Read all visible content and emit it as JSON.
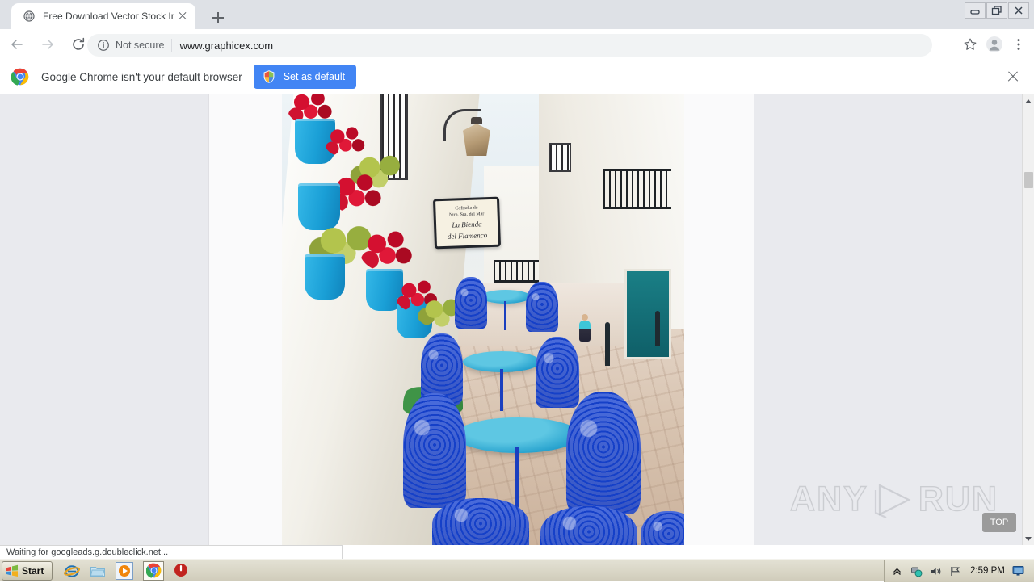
{
  "browser": {
    "tab": {
      "title": "Free Download Vector Stock Image F",
      "favicon": "globe-icon",
      "close": "close-icon"
    },
    "new_tab_label": "+",
    "window_controls": {
      "minimize": "minimize-icon",
      "restore": "restore-icon",
      "close": "window-close-icon"
    },
    "nav": {
      "back": "back-arrow-icon",
      "forward": "forward-arrow-icon",
      "reload": "reload-icon"
    },
    "omnibox": {
      "security_icon": "info-circle-icon",
      "security_label": "Not secure",
      "url": "www.graphicex.com"
    },
    "toolbar_right": {
      "bookmark": "star-icon",
      "profile": "avatar-icon",
      "menu": "three-dot-menu-icon"
    },
    "infobar": {
      "logo": "chrome-logo-icon",
      "message": "Google Chrome isn't your default browser",
      "button_label": "Set as default",
      "button_icon": "shield-icon",
      "button_color": "#4285f4",
      "close": "infobar-close-icon"
    },
    "status": {
      "text": "Waiting for googleads.g.doubleclick.net..."
    },
    "scrollbar": {
      "up": "scroll-up-arrow-icon",
      "down": "scroll-down-arrow-icon"
    }
  },
  "page": {
    "photo": {
      "alt": "Mediterranean village street with blue flower pots and blue wrought-iron cafe tables",
      "sign_line1": "Cofradia de",
      "sign_line2": "Ntra. Sra. del Mar",
      "sign_script1": "La Bienda",
      "sign_script2": "del Flamenco"
    },
    "watermark": {
      "left": "ANY",
      "right": "RUN",
      "play_icon": "play-triangle-icon"
    },
    "top_button": "TOP"
  },
  "taskbar": {
    "start_label": "Start",
    "start_icon": "windows-flag-icon",
    "quick_launch": [
      {
        "name": "internet-explorer-icon"
      },
      {
        "name": "file-explorer-icon"
      },
      {
        "name": "media-player-icon"
      },
      {
        "name": "chrome-taskbar-icon"
      },
      {
        "name": "shutdown-icon"
      }
    ],
    "tray": {
      "expand": "tray-expand-icon",
      "network": "network-icon",
      "volume": "volume-icon",
      "flag": "security-flag-icon",
      "time": "2:59 PM",
      "display": "display-icon"
    }
  },
  "colors": {
    "tabstrip_bg": "#dee1e6",
    "omnibox_bg": "#f1f3f4",
    "accent_blue": "#4285f4",
    "page_bg": "#e9eaee"
  }
}
